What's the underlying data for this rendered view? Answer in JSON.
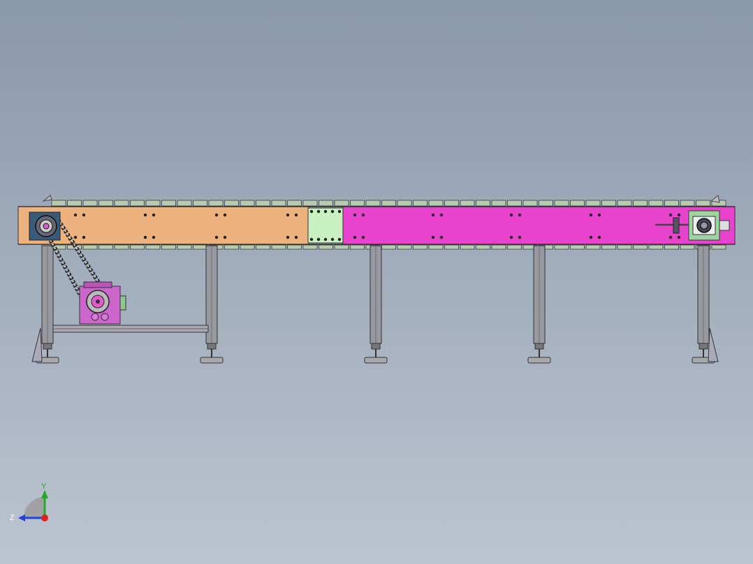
{
  "viewport": {
    "background_top": "#8a98ab",
    "background_bottom": "#bcc4d0"
  },
  "model": {
    "frame_left_color": "#eeb27e",
    "frame_right_color": "#e843cc",
    "cover_plate_color": "#c8f0c0",
    "gearbox_color": "#cc66cc",
    "leg_color": "#9898a0",
    "chain_color": "#303030"
  },
  "triad": {
    "y_label": "Y",
    "z_label": "Z",
    "y_color": "#22aa22",
    "z_color": "#2244dd",
    "x_color": "#dd2222"
  }
}
